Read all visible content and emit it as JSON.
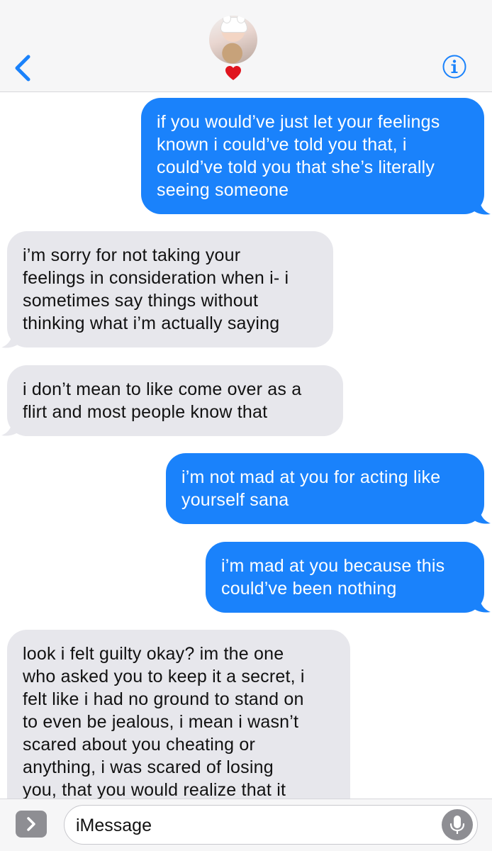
{
  "header": {
    "contact_emoji": "❤️"
  },
  "messages": [
    {
      "side": "sent",
      "text": "if you would’ve just let your feelings\nknown i could’ve told you that, i\ncould’ve told you that she’s literally\nseeing someone"
    },
    {
      "side": "recv",
      "text": "i’m sorry for not taking your\nfeelings in consideration when i- i\nsometimes say things without\nthinking what i’m actually saying"
    },
    {
      "side": "recv",
      "text": "i don’t mean to like come over as a\nflirt and most people know that"
    },
    {
      "side": "sent",
      "text": "i’m not mad at you for acting like\nyourself sana"
    },
    {
      "side": "sent",
      "text": "i’m mad at you because this\ncould’ve been nothing"
    },
    {
      "side": "recv",
      "text": "look i felt guilty okay? im the one\nwho asked you to keep it a secret, i\nfelt like i had no ground to stand on\nto even be jealous, i mean i wasn’t\nscared about you cheating or\nanything, i was scared of losing\nyou, that you would realize that it"
    }
  ],
  "input": {
    "placeholder": "iMessage"
  },
  "colors": {
    "sent": "#1a82fb",
    "received": "#e7e7ec",
    "accent": "#1a82fb"
  },
  "icons": {
    "back": "chevron-left-icon",
    "info": "info-icon",
    "apps": "chevron-right-icon",
    "mic": "microphone-icon"
  }
}
